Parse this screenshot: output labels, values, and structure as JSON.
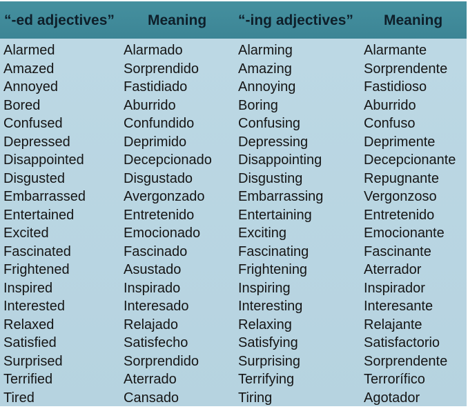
{
  "headers": [
    "“-ed adjectives”",
    "Meaning",
    "“-ing adjectives”",
    "Meaning"
  ],
  "colors": {
    "header_bg": "#3f8898",
    "body_bg": "#b9d6e2",
    "text": "#151515"
  },
  "rows": [
    [
      "Alarmed",
      "Alarmado",
      "Alarming",
      "Alarmante"
    ],
    [
      "Amazed",
      "Sorprendido",
      "Amazing",
      "Sorprendente"
    ],
    [
      "Annoyed",
      "Fastidiado",
      "Annoying",
      "Fastidioso"
    ],
    [
      "Bored",
      "Aburrido",
      "Boring",
      "Aburrido"
    ],
    [
      "Confused",
      "Confundido",
      "Confusing",
      "Confuso"
    ],
    [
      "Depressed",
      "Deprimido",
      "Depressing",
      "Deprimente"
    ],
    [
      "Disappointed",
      "Decepcionado",
      "Disappointing",
      "Decepcionante"
    ],
    [
      "Disgusted",
      "Disgustado",
      "Disgusting",
      "Repugnante"
    ],
    [
      "Embarrassed",
      "Avergonzado",
      "Embarrassing",
      "Vergonzoso"
    ],
    [
      "Entertained",
      "Entretenido",
      "Entertaining",
      "Entretenido"
    ],
    [
      "Excited",
      "Emocionado",
      "Exciting",
      "Emocionante"
    ],
    [
      "Fascinated",
      "Fascinado",
      "Fascinating",
      "Fascinante"
    ],
    [
      "Frightened",
      "Asustado",
      "Frightening",
      "Aterrador"
    ],
    [
      "Inspired",
      "Inspirado",
      "Inspiring",
      "Inspirador"
    ],
    [
      "Interested",
      "Interesado",
      "Interesting",
      "Interesante"
    ],
    [
      "Relaxed",
      "Relajado",
      "Relaxing",
      "Relajante"
    ],
    [
      "Satisfied",
      "Satisfecho",
      "Satisfying",
      "Satisfactorio"
    ],
    [
      "Surprised",
      "Sorprendido",
      "Surprising",
      "Sorprendente"
    ],
    [
      "Terrified",
      "Aterrado",
      "Terrifying",
      "Terrorífico"
    ],
    [
      "Tired",
      "Cansado",
      "Tiring",
      "Agotador"
    ]
  ]
}
